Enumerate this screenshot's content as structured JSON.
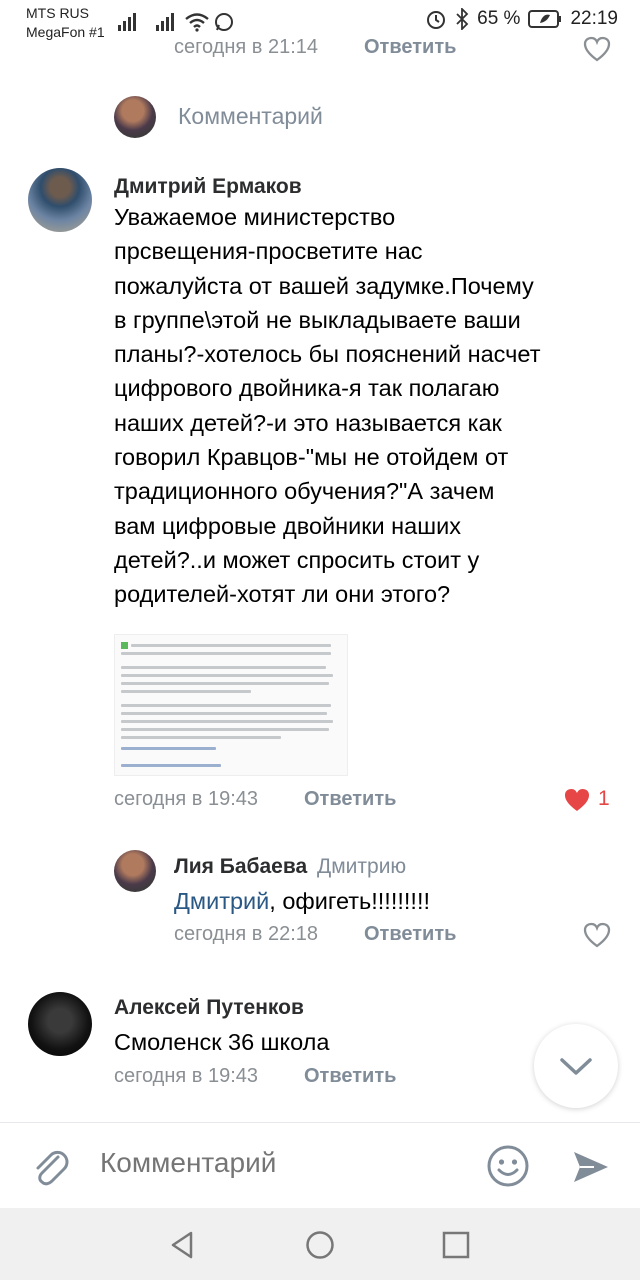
{
  "status_bar": {
    "carrier1": "MTS RUS",
    "carrier2": "MegaFon #1",
    "battery": "65 %",
    "time": "22:19"
  },
  "top_partial": {
    "time": "сегодня в 21:14",
    "reply": "Ответить"
  },
  "comment_prompt": "Комментарий",
  "comments": [
    {
      "author": "Дмитрий Ермаков",
      "lines": [
        "Уважаемое министерство",
        "прсвещения-просветите нас",
        "пожалуйста от вашей задумке.Почему",
        "в группе\\этой не выкладываете ваши",
        "планы?-хотелось бы пояснений насчет",
        "цифрового двойника-я так полагаю",
        "наших детей?-и это называется как",
        "говорил Кравцов-\"мы не отойдем от",
        "традиционного обучения?\"А зачем",
        "вам цифровые двойники наших",
        "детей?..и может спросить стоит у",
        "родителей-хотят ли они этого?"
      ],
      "time": "сегодня в 19:43",
      "reply": "Ответить",
      "likes": "1"
    },
    {
      "author": "Лия Бабаева",
      "to": "Дмитрию",
      "mention": "Дмитрий",
      "text": ", офигеть!!!!!!!!!",
      "time": "сегодня в 22:18",
      "reply": "Ответить"
    },
    {
      "author": "Алексей Путенков",
      "text": "Смоленск 36 школа",
      "time": "сегодня в 19:43",
      "reply": "Ответить"
    }
  ],
  "composer": {
    "placeholder": "Комментарий"
  },
  "colors": {
    "link": "#2a5885",
    "like": "#e64646",
    "muted": "#818c99"
  },
  "icons": [
    "paperclip-icon",
    "smile-icon",
    "send-icon",
    "chevron-down-icon",
    "heart-icon"
  ]
}
